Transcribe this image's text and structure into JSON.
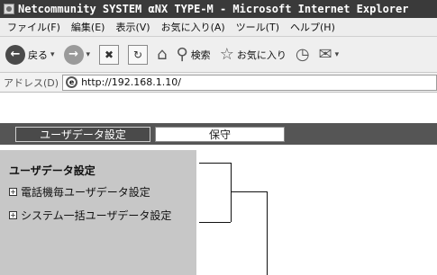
{
  "window": {
    "title": "Netcommunity SYSTEM αNX TYPE-M - Microsoft Internet Explorer"
  },
  "menubar": {
    "items": [
      "ファイル(F)",
      "編集(E)",
      "表示(V)",
      "お気に入り(A)",
      "ツール(T)",
      "ヘルプ(H)"
    ]
  },
  "toolbar": {
    "back_label": "戻る",
    "search_label": "検索",
    "favorites_label": "お気に入り"
  },
  "address": {
    "label": "アドレス(D)",
    "url": "http://192.168.1.10/"
  },
  "header": {
    "tab_user_data": "ユーザデータ設定",
    "tab_maintenance": "保守"
  },
  "sidebar": {
    "title": "ユーザデータ設定",
    "items": [
      {
        "label": "電話機毎ユーザデータ設定"
      },
      {
        "label": "システム一括ユーザデータ設定"
      }
    ]
  },
  "colors": {
    "title_bar": "#3a3a3a",
    "header_band": "#555555",
    "sidebar_bg": "#c7c7c7"
  }
}
